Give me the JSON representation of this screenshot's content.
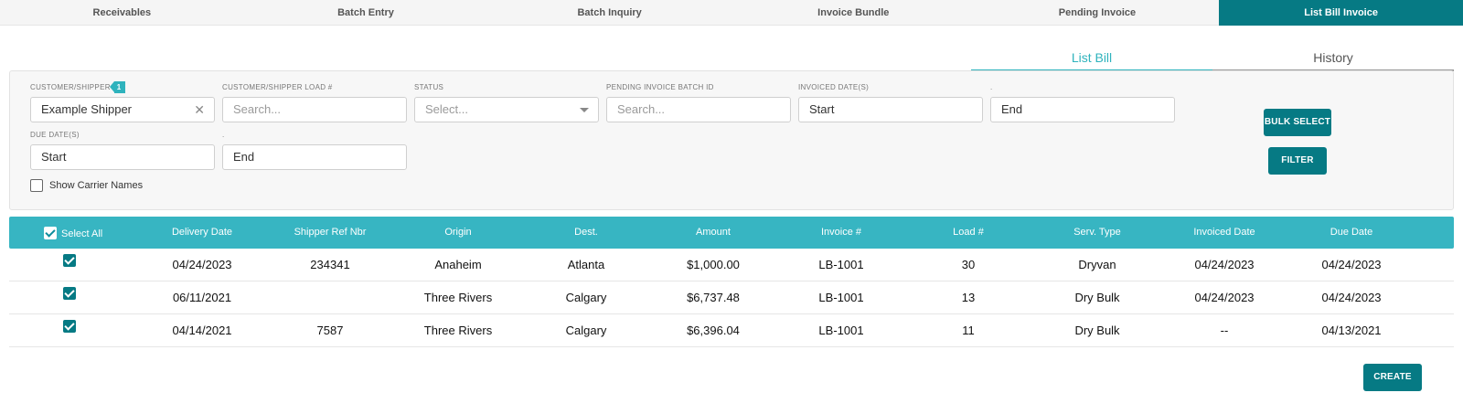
{
  "top_tabs": [
    {
      "label": "Receivables"
    },
    {
      "label": "Batch Entry"
    },
    {
      "label": "Batch Inquiry"
    },
    {
      "label": "Invoice Bundle"
    },
    {
      "label": "Pending Invoice"
    },
    {
      "label": "List Bill Invoice",
      "active": true
    }
  ],
  "sub_tabs": [
    {
      "label": "List Bill",
      "active": true
    },
    {
      "label": "History"
    }
  ],
  "filters": {
    "customer": {
      "label": "CUSTOMER/SHIPPER",
      "badge": "1",
      "value": "Example Shipper",
      "clear_icon": "close-icon"
    },
    "load": {
      "label": "CUSTOMER/SHIPPER LOAD #",
      "placeholder": "Search..."
    },
    "status": {
      "label": "STATUS",
      "placeholder": "Select..."
    },
    "batch": {
      "label": "PENDING INVOICE BATCH ID",
      "placeholder": "Search..."
    },
    "invoiced": {
      "label": "INVOICED DATE(S)",
      "start": "Start",
      "end_label": ".",
      "end": "End"
    },
    "due": {
      "label": "DUE DATE(S)",
      "start": "Start",
      "end_label": ".",
      "end": "End"
    },
    "show_carrier": {
      "label": "Show Carrier Names",
      "checked": false
    }
  },
  "buttons": {
    "bulk_select": "BULK SELECT",
    "filter": "FILTER",
    "create": "CREATE"
  },
  "table": {
    "select_all": "Select All",
    "columns": [
      "Delivery Date",
      "Shipper Ref Nbr",
      "Origin",
      "Dest.",
      "Amount",
      "Invoice #",
      "Load #",
      "Serv. Type",
      "Invoiced Date",
      "Due Date"
    ],
    "rows": [
      {
        "checked": true,
        "cells": [
          "04/24/2023",
          "234341",
          "Anaheim",
          "Atlanta",
          "$1,000.00",
          "LB-1001",
          "30",
          "Dryvan",
          "04/24/2023",
          "04/24/2023"
        ]
      },
      {
        "checked": true,
        "cells": [
          "06/11/2021",
          "",
          "Three Rivers",
          "Calgary",
          "$6,737.48",
          "LB-1001",
          "13",
          "Dry Bulk",
          "04/24/2023",
          "04/24/2023"
        ]
      },
      {
        "checked": true,
        "cells": [
          "04/14/2021",
          "7587",
          "Three Rivers",
          "Calgary",
          "$6,396.04",
          "LB-1001",
          "11",
          "Dry Bulk",
          "--",
          "04/13/2021"
        ]
      }
    ]
  },
  "colors": {
    "accent": "#067a84",
    "header": "#37b5c2",
    "active_subtab": "#2fb3bd"
  }
}
